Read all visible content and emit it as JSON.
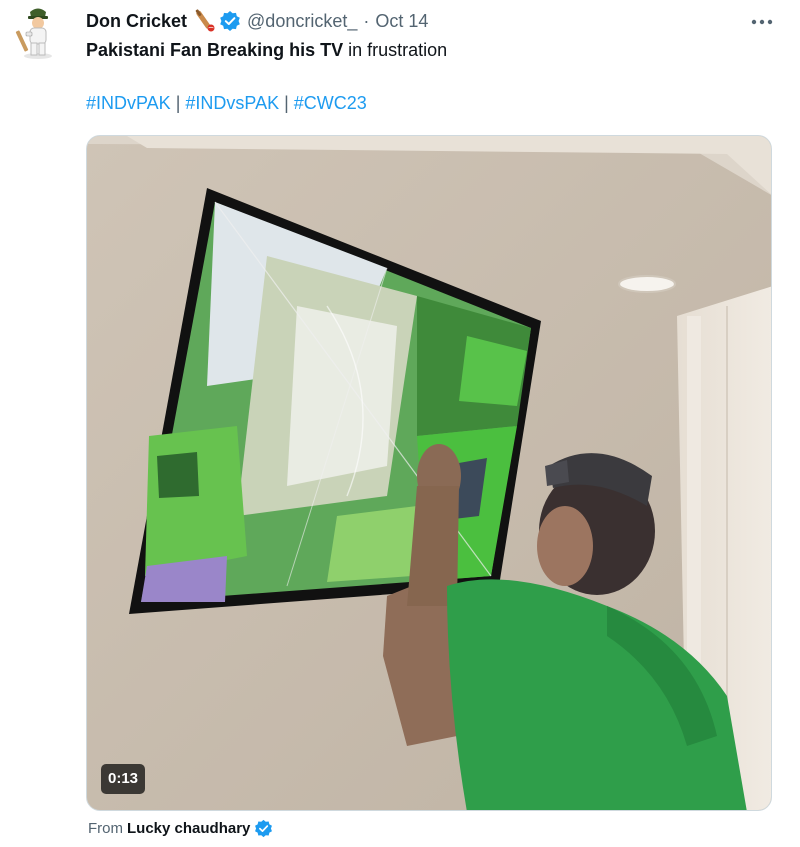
{
  "tweet": {
    "author": {
      "display_name": "Don Cricket",
      "handle": "@doncricket_",
      "separator": "·",
      "date": "Oct 14",
      "avatar_icon": "cricketer-avatar-icon",
      "name_emoji_icon": "cricket-bat-icon",
      "verified_icon": "verified-badge-icon"
    },
    "more_icon": "more-options-icon",
    "text": {
      "bold_part": "Pakistani Fan Breaking his TV",
      "normal_part": " in frustration"
    },
    "hashtags": [
      "#INDvPAK",
      "#INDvsPAK",
      "#CWC23"
    ],
    "hashtag_separator": " | ",
    "media": {
      "type": "video",
      "duration": "0:13"
    },
    "attribution": {
      "prefix": "From",
      "source_name": "Lucky chaudhary",
      "verified_icon": "verified-badge-icon"
    }
  },
  "colors": {
    "accent": "#1d9bf0",
    "text_primary": "#0f1419",
    "text_secondary": "#536471",
    "verified": "#1d9bf0"
  }
}
